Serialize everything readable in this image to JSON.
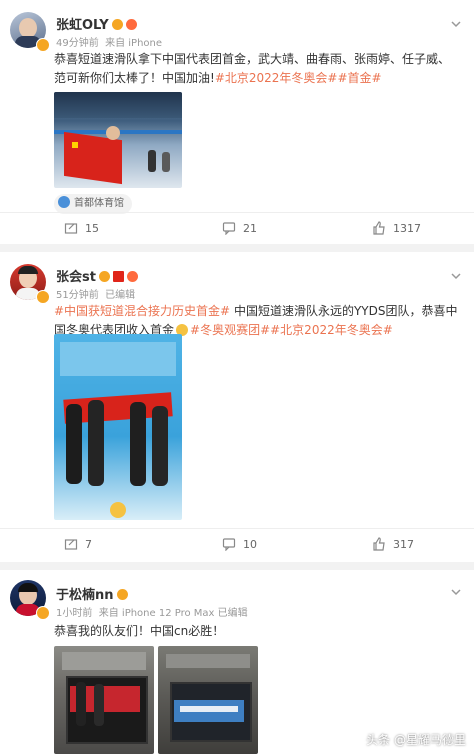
{
  "posts": [
    {
      "username": "张虹OLY",
      "time": "49分钟前",
      "source": "来自 iPhone",
      "text_before": "恭喜短道速滑队拿下中国代表团首金，武大靖、曲春雨、张雨婷、任子威、范可新你们太棒了！中国加油!",
      "text_hashtag": "#北京2022年冬奥会##首金#",
      "location": "首都体育馆",
      "reposts": "15",
      "comments": "21",
      "likes": "1317"
    },
    {
      "username": "张会st",
      "time": "51分钟前",
      "source": "已编辑",
      "text_hashtag1": "#中国获短道混合接力历史首金#",
      "text_middle": " 中国短道速滑队永远的YYDS团队，恭喜中国冬奥代表团收入首金",
      "text_hashtag2": "#冬奥观赛团##北京2022年冬奥会#",
      "reposts": "7",
      "comments": "10",
      "likes": "317"
    },
    {
      "username": "于松楠nn",
      "time": "1小时前",
      "source": "来自 iPhone 12 Pro Max 已编辑",
      "text": "恭喜我的队友们！中国cn必胜！"
    }
  ],
  "watermark": "头条 @星耀马德里",
  "colors": {
    "accent": "#eb7350",
    "badge": "#f5a623",
    "location_dot": "#4a90d9"
  },
  "icons": [
    "repost-icon",
    "comment-icon",
    "like-icon",
    "chevron-down-icon",
    "location-icon",
    "verified-badge-icon"
  ]
}
